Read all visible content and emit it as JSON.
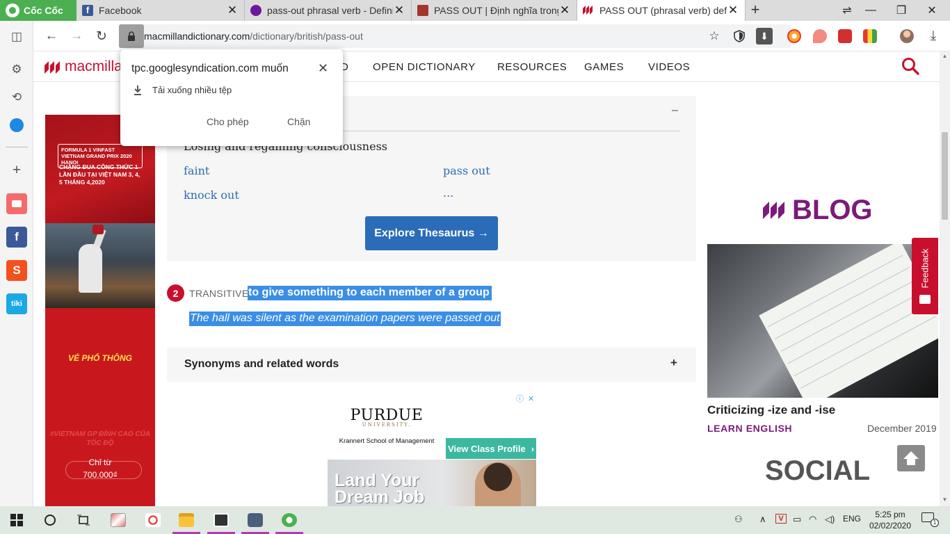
{
  "browser": {
    "brand": "Cốc Cốc",
    "tabs": [
      {
        "title": "Facebook",
        "favicon_color": "#3b5998"
      },
      {
        "title": "pass-out phrasal verb - Defini",
        "favicon_color": "#6a1b9a"
      },
      {
        "title": "PASS OUT | Định nghĩa trong",
        "favicon_color": "#a3352b"
      },
      {
        "title": "PASS OUT (phrasal verb) defin",
        "favicon_color": "#c8102e",
        "active": true
      }
    ],
    "address": {
      "domain": "macmillandictionary.com",
      "path": "/dictionary/british/pass-out"
    }
  },
  "permission_popup": {
    "title": "tpc.googlesyndication.com muốn",
    "request": "Tải xuống nhiều tệp",
    "allow_label": "Cho phép",
    "block_label": "Chặn"
  },
  "site": {
    "brand": "macmillan",
    "nav": [
      "D",
      "OPEN DICTIONARY",
      "RESOURCES",
      "GAMES",
      "VIDEOS"
    ]
  },
  "thesaurus": {
    "sense": "Losing and regaining consciousness",
    "words": [
      "faint",
      "pass out",
      "knock out",
      "..."
    ],
    "button": "Explore Thesaurus →"
  },
  "sense2": {
    "number": "2",
    "grammar": "TRANSITIVE",
    "definition": "to give something to each member of a group",
    "example": "The hall was silent as the examination papers were passed out",
    "example_end": "."
  },
  "synonyms": {
    "title": "Synonyms and related words",
    "toggle": "+"
  },
  "left_ad": {
    "f1_title": "FORMULA 1 VINFAST VIETNAM GRAND PRIX 2020 HANOI",
    "headline": "CHẶNG ĐUA CÔNG THỨC 1 LẦN ĐẦU TẠI VIỆT NAM 3, 4, 5 THÁNG 4,2020",
    "ticket": "VÉ PHỔ THÔNG",
    "tagline": "#VIETNAM GP ĐỈNH CAO CỦA TỐC ĐỘ",
    "price_label": "Chỉ từ",
    "price": "700.000₫"
  },
  "bottom_ad": {
    "school": "PURDUE",
    "university": "UNIVERSITY.",
    "sub": "Krannert School of Management",
    "cta": "View Class Profile",
    "banner": "Land Your Dream Job"
  },
  "blog": {
    "heading": "BLOG",
    "post_title": "Criticizing -ize and -ise",
    "category": "LEARN ENGLISH",
    "date": "December 2019"
  },
  "social": {
    "heading": "SOCIAL"
  },
  "feedback": {
    "label": "Feedback"
  },
  "taskbar": {
    "lang": "ENG",
    "time": "5:25 pm",
    "date": "02/02/2020",
    "notifications": "1"
  },
  "colors": {
    "brand_red": "#c8102e",
    "link_blue": "#2b6cb0",
    "button_blue": "#2a6cb8",
    "selection_blue": "#3a8ee6",
    "blog_purple": "#7b1a7a"
  }
}
